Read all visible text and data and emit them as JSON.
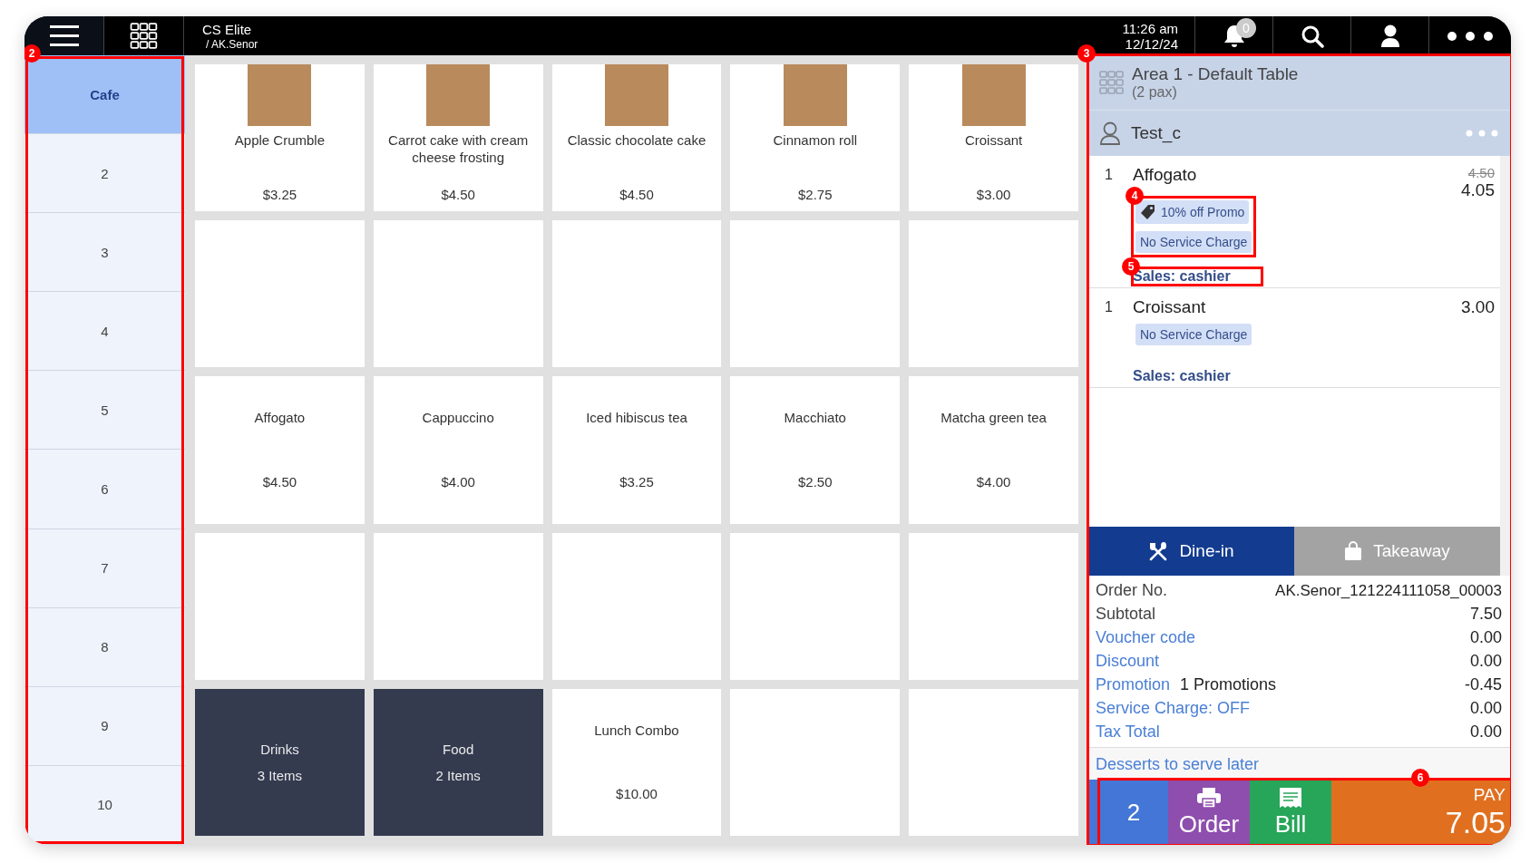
{
  "top_bar": {
    "store": "CS Elite",
    "user": "/ AK.Senor",
    "time": "11:26 am",
    "date": "12/12/24",
    "notification_count": "0"
  },
  "sidebar": {
    "callout": "2",
    "items": [
      {
        "label": "Cafe",
        "selected": true
      },
      {
        "label": "2",
        "selected": false
      },
      {
        "label": "3",
        "selected": false
      },
      {
        "label": "4",
        "selected": false
      },
      {
        "label": "5",
        "selected": false
      },
      {
        "label": "6",
        "selected": false
      },
      {
        "label": "7",
        "selected": false
      },
      {
        "label": "8",
        "selected": false
      },
      {
        "label": "9",
        "selected": false
      },
      {
        "label": "10",
        "selected": false
      }
    ]
  },
  "tiles": [
    {
      "kind": "product",
      "image": true,
      "name": "Apple Crumble",
      "price": "$3.25"
    },
    {
      "kind": "product",
      "image": true,
      "name": "Carrot cake with cream cheese frosting",
      "price": "$4.50"
    },
    {
      "kind": "product",
      "image": true,
      "name": "Classic chocolate cake",
      "price": "$4.50"
    },
    {
      "kind": "product",
      "image": true,
      "name": "Cinnamon roll",
      "price": "$2.75"
    },
    {
      "kind": "product",
      "image": true,
      "name": "Croissant",
      "price": "$3.00"
    },
    {
      "kind": "empty"
    },
    {
      "kind": "empty"
    },
    {
      "kind": "empty"
    },
    {
      "kind": "empty"
    },
    {
      "kind": "empty"
    },
    {
      "kind": "product",
      "image": false,
      "name": "Affogato",
      "price": "$4.50"
    },
    {
      "kind": "product",
      "image": false,
      "name": "Cappuccino",
      "price": "$4.00"
    },
    {
      "kind": "product",
      "image": false,
      "name": "Iced hibiscus tea",
      "price": "$3.25"
    },
    {
      "kind": "product",
      "image": false,
      "name": "Macchiato",
      "price": "$2.50"
    },
    {
      "kind": "product",
      "image": false,
      "name": "Matcha green tea",
      "price": "$4.00"
    },
    {
      "kind": "empty"
    },
    {
      "kind": "empty"
    },
    {
      "kind": "empty"
    },
    {
      "kind": "empty"
    },
    {
      "kind": "empty"
    },
    {
      "kind": "category",
      "name": "Drinks",
      "count": "3 Items"
    },
    {
      "kind": "category",
      "name": "Food",
      "count": "2 Items"
    },
    {
      "kind": "product",
      "image": false,
      "name": "Lunch Combo",
      "price": "$10.00"
    },
    {
      "kind": "empty"
    },
    {
      "kind": "empty"
    }
  ],
  "order_panel": {
    "callout": "3",
    "table": "Area 1 - Default Table",
    "pax": "(2 pax)",
    "customer": "Test_c",
    "items": [
      {
        "qty": "1",
        "name": "Affogato",
        "original_price": "4.50",
        "price": "4.05",
        "tags_callout": "4",
        "sales_callout": "5",
        "tags": [
          {
            "kind": "promo",
            "label": "10% off Promo"
          },
          {
            "kind": "plain",
            "label": "No Service Charge"
          }
        ],
        "sales": "Sales: cashier"
      },
      {
        "qty": "1",
        "name": "Croissant",
        "price": "3.00",
        "tags": [
          {
            "kind": "plain",
            "label": "No Service Charge"
          }
        ],
        "sales": "Sales: cashier"
      }
    ],
    "tabs": [
      {
        "kind": "dine-in",
        "label": "Dine-in",
        "selected": true
      },
      {
        "kind": "takeaway",
        "label": "Takeaway",
        "selected": false
      }
    ],
    "summary": [
      {
        "kind": "plain",
        "label": "Order No.",
        "value": "AK.Senor_121224111058_00003"
      },
      {
        "kind": "plain",
        "label": "Subtotal",
        "value": "7.50"
      },
      {
        "kind": "link",
        "label": "Voucher code",
        "value": "0.00"
      },
      {
        "kind": "link",
        "label": "Discount",
        "value": "0.00"
      },
      {
        "kind": "link",
        "label": "Promotion",
        "detail": "1 Promotions",
        "value": "-0.45"
      },
      {
        "kind": "link",
        "label": "Service Charge: OFF",
        "value": "0.00"
      },
      {
        "kind": "link",
        "label": "Tax Total",
        "value": "0.00"
      }
    ],
    "note": "Desserts to serve later",
    "actions": {
      "callout": "6",
      "count": "2",
      "order": "Order",
      "bill": "Bill",
      "pay_label": "PAY",
      "pay_amount": "7.05"
    }
  }
}
